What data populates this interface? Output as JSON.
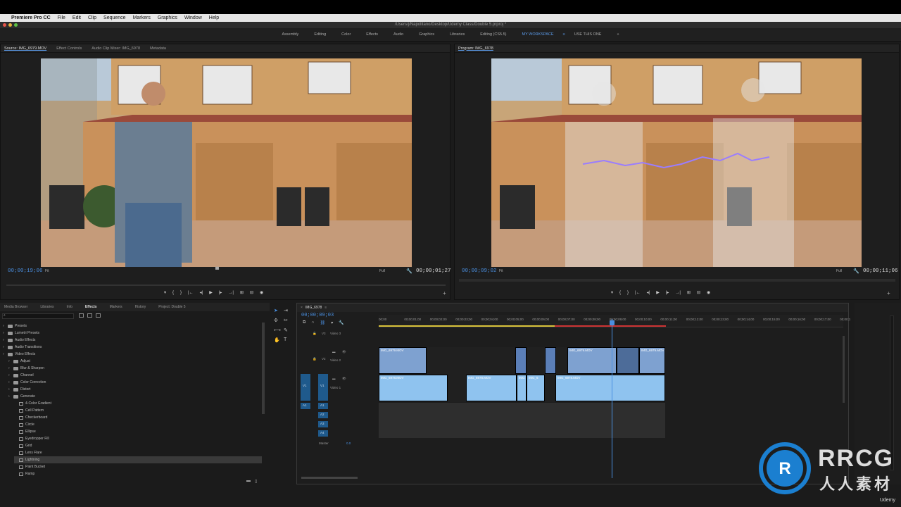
{
  "app": {
    "name": "Premiere Pro CC",
    "menu": [
      "File",
      "Edit",
      "Clip",
      "Sequence",
      "Markers",
      "Graphics",
      "Window",
      "Help"
    ],
    "title_path": "/Users/j/Napolitano/Desktop/Udemy Class/Double 5.prproj *"
  },
  "workspaces": {
    "items": [
      "Assembly",
      "Editing",
      "Color",
      "Effects",
      "Audio",
      "Graphics",
      "Libraries",
      "Editing (CS5.5)",
      "MY WORKSPACE",
      "USE THIS ONE"
    ],
    "active": "MY WORKSPACE",
    "more": "»"
  },
  "source_monitor": {
    "tabs": [
      "Source: IMG_6979.MOV",
      "Effect Controls",
      "Audio Clip Mixer: IMG_6978",
      "Metadata"
    ],
    "timecode": "00;00;19;06",
    "fit": "Fit",
    "quality": "Full",
    "duration": "00;00;01;27"
  },
  "program_monitor": {
    "tab": "Program: IMG_6978",
    "timecode": "00;00;09;02",
    "fit": "Fit",
    "quality": "Full",
    "duration": "00;00;11;06"
  },
  "project_panel": {
    "tabs": [
      "Media Browser",
      "Libraries",
      "Info",
      "Effects",
      "Markers",
      "History",
      "Project: Double 5"
    ],
    "active_tab": "Effects",
    "tree": [
      {
        "label": "Presets",
        "indent": 0,
        "type": "folder"
      },
      {
        "label": "Lumetri Presets",
        "indent": 0,
        "type": "folder"
      },
      {
        "label": "Audio Effects",
        "indent": 0,
        "type": "folder"
      },
      {
        "label": "Audio Transitions",
        "indent": 0,
        "type": "folder"
      },
      {
        "label": "Video Effects",
        "indent": 0,
        "type": "folder"
      },
      {
        "label": "Adjust",
        "indent": 1,
        "type": "folder"
      },
      {
        "label": "Blur & Sharpen",
        "indent": 1,
        "type": "folder"
      },
      {
        "label": "Channel",
        "indent": 1,
        "type": "folder"
      },
      {
        "label": "Color Correction",
        "indent": 1,
        "type": "folder"
      },
      {
        "label": "Distort",
        "indent": 1,
        "type": "folder"
      },
      {
        "label": "Generate",
        "indent": 1,
        "type": "folder"
      },
      {
        "label": "4-Color Gradient",
        "indent": 2,
        "type": "fx"
      },
      {
        "label": "Cell Pattern",
        "indent": 2,
        "type": "fx"
      },
      {
        "label": "Checkerboard",
        "indent": 2,
        "type": "fx"
      },
      {
        "label": "Circle",
        "indent": 2,
        "type": "fx"
      },
      {
        "label": "Ellipse",
        "indent": 2,
        "type": "fx"
      },
      {
        "label": "Eyedropper Fill",
        "indent": 2,
        "type": "fx"
      },
      {
        "label": "Grid",
        "indent": 2,
        "type": "fx"
      },
      {
        "label": "Lens Flare",
        "indent": 2,
        "type": "fx"
      },
      {
        "label": "Lightning",
        "indent": 2,
        "type": "fx",
        "selected": true
      },
      {
        "label": "Paint Bucket",
        "indent": 2,
        "type": "fx"
      },
      {
        "label": "Ramp",
        "indent": 2,
        "type": "fx"
      }
    ]
  },
  "timeline": {
    "sequence": "IMG_6978",
    "timecode": "00;00;09;03",
    "ruler": [
      "00;00",
      "00;00;01;00",
      "00;00;02;00",
      "00;00;03;00",
      "00;00;04;00",
      "00;00;05;00",
      "00;00;06;00",
      "00;00;07;00",
      "00;00;08;00",
      "00;00;09;00",
      "00;00;10;00",
      "00;00;11;00",
      "00;00;12;00",
      "00;00;13;00",
      "00;00;14;00",
      "00;00;15;00",
      "00;00;16;00",
      "00;00;17;00",
      "00;00;1"
    ],
    "tracks": {
      "v3": "Video 3",
      "v2": "Video 2",
      "v1": "Video 1",
      "a1": "A1",
      "a2": "A2",
      "a3": "A3",
      "a4": "A4",
      "master": "Master",
      "master_val": "0.0",
      "v_src": "V1",
      "v_lbl": "V1",
      "v2_lbl": "V2",
      "v3_lbl": "V3"
    },
    "clip_names": {
      "v2a": "IMG_6979.MOV",
      "v2b": "IMG_6979.MOV",
      "v2c": "IMG_6979.MOV",
      "v1a": "IMG_6978.MOV",
      "v1b": "IMG_6978.MOV",
      "v1c": "IMG",
      "v1d": "IMG_6",
      "v1e": "IMG_6978.MOV"
    }
  },
  "watermark": {
    "brand": "RRCG",
    "sub": "人人素材",
    "udemy": "Udemy"
  },
  "colors": {
    "accent": "#4a8fe0",
    "clip_blue": "#5b7fb8",
    "clip_light": "#8fc3ef"
  }
}
